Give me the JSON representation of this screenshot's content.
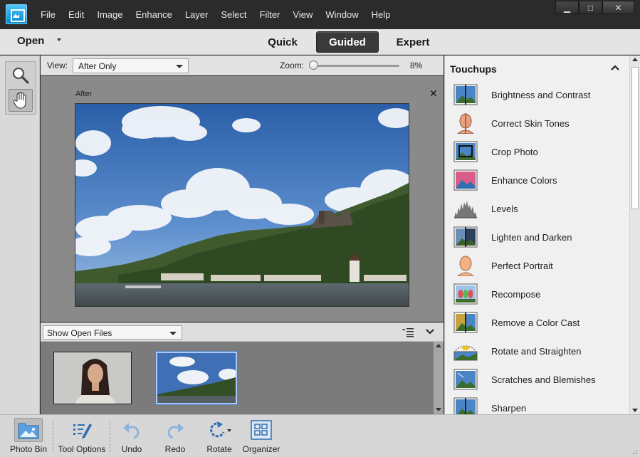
{
  "menu": {
    "items": [
      "File",
      "Edit",
      "Image",
      "Enhance",
      "Layer",
      "Select",
      "Filter",
      "View",
      "Window",
      "Help"
    ]
  },
  "window_controls": {
    "minimize": "▁",
    "maximize": "□",
    "close": "✕"
  },
  "modebar": {
    "open_label": "Open",
    "tabs": {
      "quick": "Quick",
      "guided": "Guided",
      "expert": "Expert"
    },
    "active_tab": "Guided"
  },
  "viewbar": {
    "view_label": "View:",
    "view_value": "After Only",
    "zoom_label": "Zoom:",
    "zoom_value": "8%",
    "zoom_fraction": 0
  },
  "canvas": {
    "after_label": "After",
    "close_glyph": "✕"
  },
  "bin": {
    "select_value": "Show Open Files",
    "thumbnails": [
      {
        "subject": "portrait",
        "selected": false
      },
      {
        "subject": "landscape",
        "selected": true
      }
    ]
  },
  "panel": {
    "title": "Touchups",
    "items": [
      {
        "label": "Brightness and Contrast",
        "icon": "brightness-contrast-icon"
      },
      {
        "label": "Correct Skin Tones",
        "icon": "skin-tones-icon"
      },
      {
        "label": "Crop Photo",
        "icon": "crop-photo-icon"
      },
      {
        "label": "Enhance Colors",
        "icon": "enhance-colors-icon"
      },
      {
        "label": "Levels",
        "icon": "levels-icon"
      },
      {
        "label": "Lighten and Darken",
        "icon": "lighten-darken-icon"
      },
      {
        "label": "Perfect Portrait",
        "icon": "perfect-portrait-icon"
      },
      {
        "label": "Recompose",
        "icon": "recompose-icon"
      },
      {
        "label": "Remove a Color Cast",
        "icon": "color-cast-icon"
      },
      {
        "label": "Rotate and Straighten",
        "icon": "rotate-straighten-icon"
      },
      {
        "label": "Scratches and Blemishes",
        "icon": "scratches-icon"
      },
      {
        "label": "Sharpen",
        "icon": "sharpen-icon"
      }
    ]
  },
  "taskbar": {
    "photo_bin": "Photo Bin",
    "tool_options": "Tool Options",
    "undo": "Undo",
    "redo": "Redo",
    "rotate": "Rotate",
    "organizer": "Organizer"
  },
  "colors": {
    "accent_blue": "#1e88e5",
    "title_bg": "#2b2b2b",
    "panel_bg": "#f0f0f0",
    "canvas_bg": "#8a8a8a"
  }
}
